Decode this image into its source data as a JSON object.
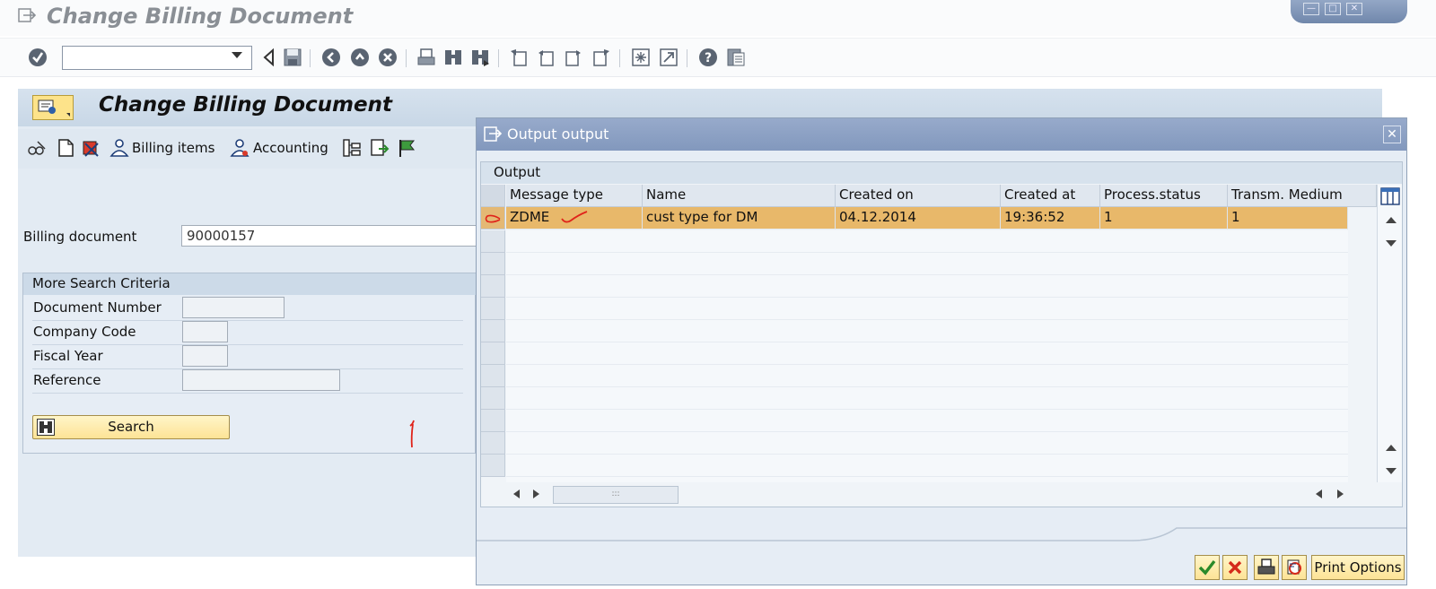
{
  "window": {
    "title": "Change Billing Document"
  },
  "command_field": {
    "value": ""
  },
  "screen": {
    "title": "Change Billing Document",
    "toolbar": {
      "billing_items_label": "Billing items",
      "accounting_label": "Accounting"
    },
    "billing_document": {
      "label": "Billing document",
      "value": "90000157"
    },
    "more_search": {
      "title": "More Search Criteria",
      "fields": [
        {
          "label": "Document Number",
          "value": ""
        },
        {
          "label": "Company Code",
          "value": ""
        },
        {
          "label": "Fiscal Year",
          "value": ""
        },
        {
          "label": "Reference",
          "value": ""
        }
      ],
      "search_label": "Search"
    }
  },
  "popup": {
    "title": "Output output",
    "panel_title": "Output",
    "columns": [
      "Message type",
      "Name",
      "Created on",
      "Created at",
      "Process.status",
      "Transm. Medium"
    ],
    "rows": [
      {
        "message_type": "ZDME",
        "name": "cust type for DM",
        "created_on": "04.12.2014",
        "created_at": "19:36:52",
        "process_status": "1",
        "transm_medium": "1"
      }
    ],
    "print_options_label": "Print Options"
  },
  "colors": {
    "selected_row": "#e8b86a",
    "button_yellow": "#fde396",
    "popup_title": "#8298bd",
    "annotation_red": "#e0231a"
  }
}
